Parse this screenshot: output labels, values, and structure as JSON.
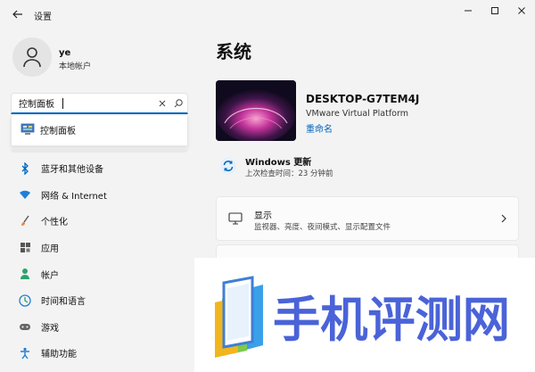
{
  "window": {
    "app_title": "设置",
    "controls": [
      "minimize-icon",
      "maximize-icon",
      "close-icon"
    ]
  },
  "account": {
    "user_name": "ye",
    "account_type": "本地帐户"
  },
  "search": {
    "value": "控制面板",
    "suggestion": "控制面板"
  },
  "nav": {
    "items": [
      {
        "label": "蓝牙和其他设备",
        "icon": "bluetooth-icon"
      },
      {
        "label": "网络 & Internet",
        "icon": "wifi-icon"
      },
      {
        "label": "个性化",
        "icon": "brush-icon"
      },
      {
        "label": "应用",
        "icon": "apps-icon"
      },
      {
        "label": "帐户",
        "icon": "person-icon"
      },
      {
        "label": "时间和语言",
        "icon": "globe-clock-icon"
      },
      {
        "label": "游戏",
        "icon": "gamepad-icon"
      },
      {
        "label": "辅助功能",
        "icon": "accessibility-icon"
      }
    ]
  },
  "main": {
    "page_title": "系统",
    "device": {
      "name": "DESKTOP-G7TEM4J",
      "model": "VMware Virtual Platform",
      "rename": "重命名"
    },
    "update": {
      "title": "Windows 更新",
      "subtitle": "上次检查时间：23 分钟前"
    },
    "cards": [
      {
        "title": "显示",
        "subtitle": "监视器、亮度、夜间模式、显示配置文件",
        "icon": "monitor-icon"
      }
    ]
  },
  "watermark": {
    "text": "手机评测网"
  },
  "colors": {
    "accent": "#0067c0",
    "background": "#f3f3f3",
    "card": "#fbfbfb",
    "watermark_text": "#4a63d8"
  }
}
